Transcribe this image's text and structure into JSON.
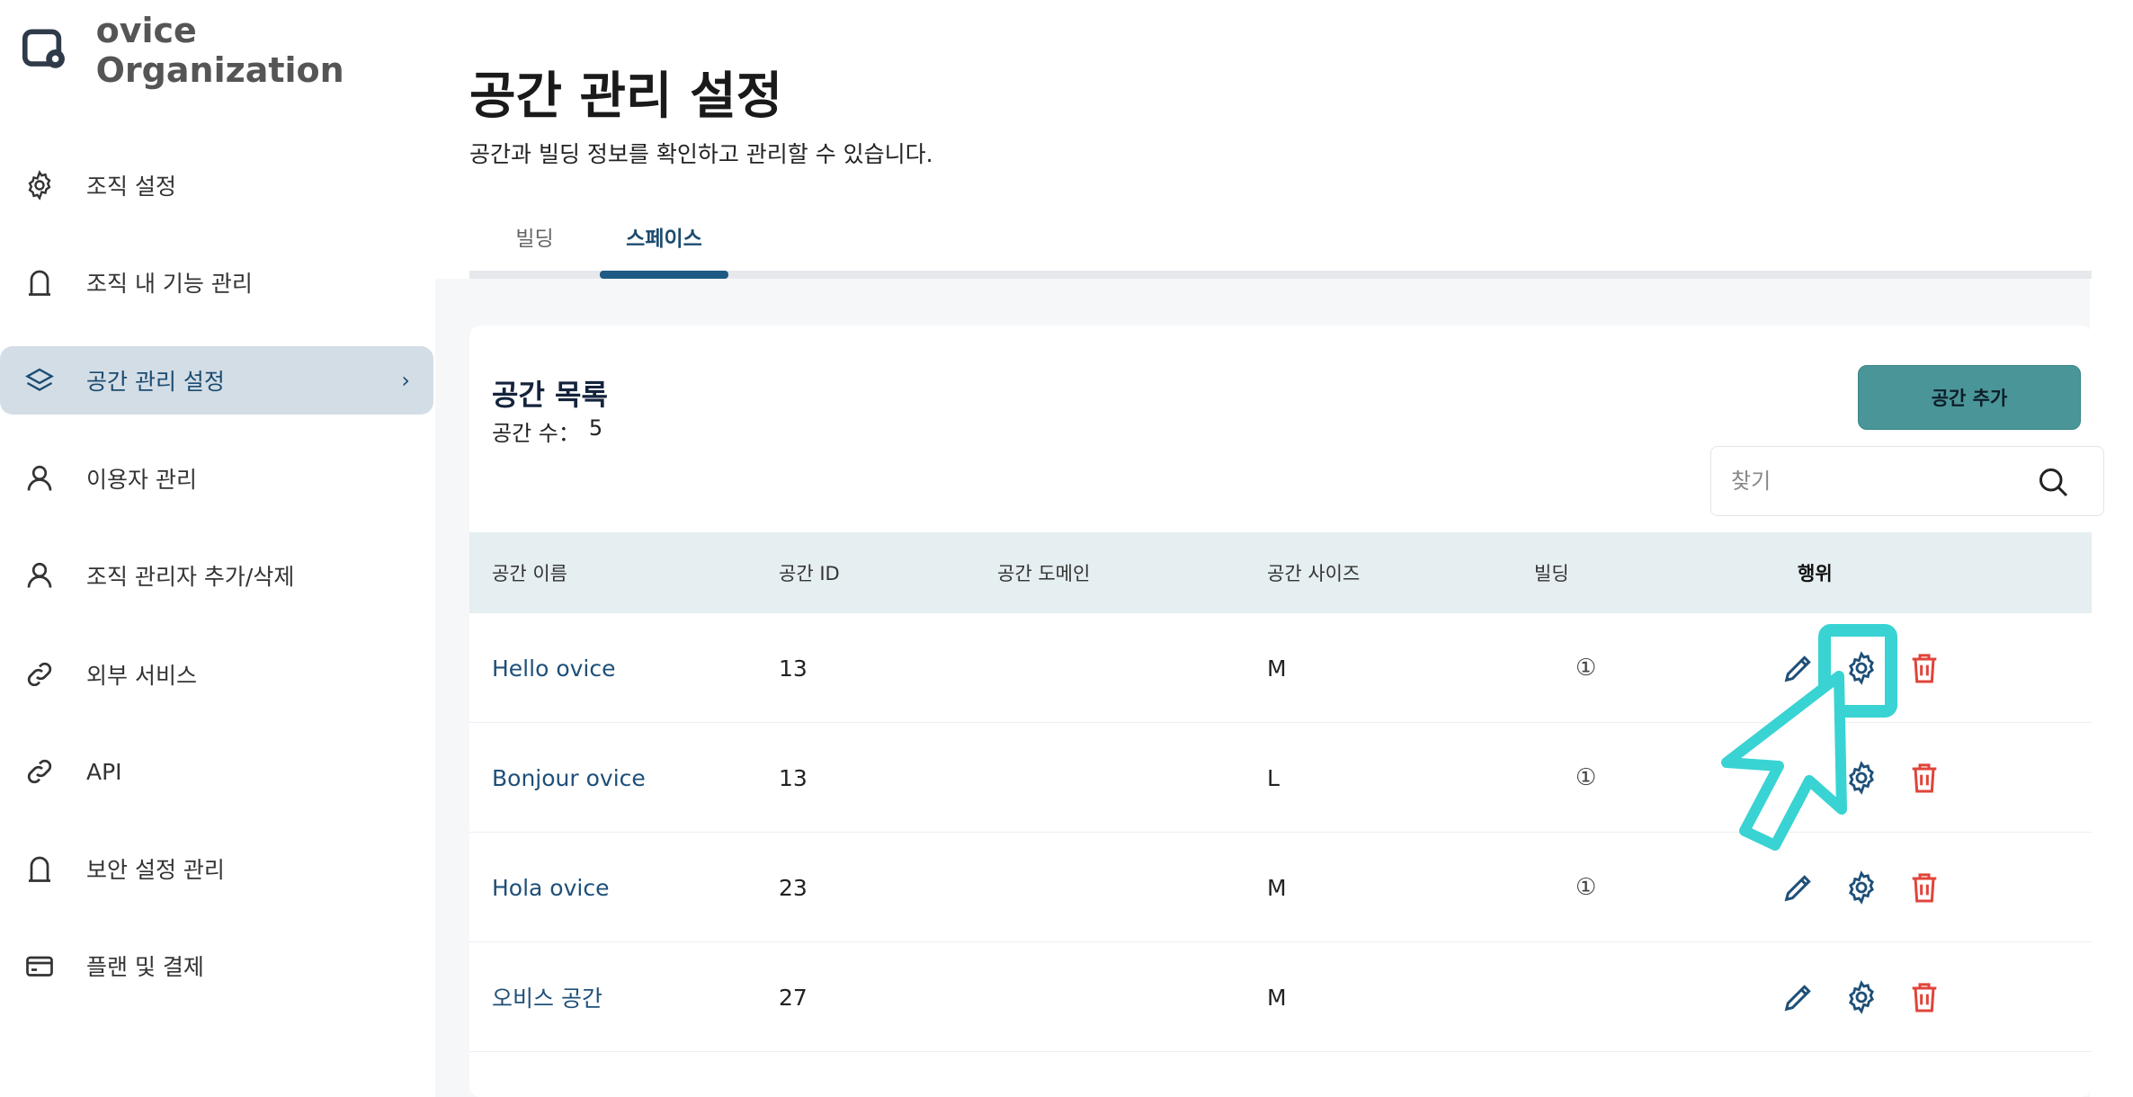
{
  "sidebar": {
    "org_name": "ovice Organization",
    "items": [
      {
        "label": "조직 설정",
        "icon": "gear-icon"
      },
      {
        "label": "조직 내 기능 관리",
        "icon": "lock-icon"
      },
      {
        "label": "공간 관리 설정",
        "icon": "layers-icon",
        "active": true
      },
      {
        "label": "이용자 관리",
        "icon": "user-icon"
      },
      {
        "label": "조직 관리자 추가/삭제",
        "icon": "user-icon"
      },
      {
        "label": "외부 서비스",
        "icon": "link-icon"
      },
      {
        "label": "API",
        "icon": "link-icon"
      },
      {
        "label": "보안 설정 관리",
        "icon": "lock-icon"
      },
      {
        "label": "플랜 및 결제",
        "icon": "credit-card-icon"
      }
    ],
    "active_chevron": "›"
  },
  "header": {
    "title": "공간 관리 설정",
    "subtitle": "공간과 빌딩 정보를 확인하고 관리할 수 있습니다."
  },
  "tabs": [
    {
      "label": "빌딩"
    },
    {
      "label": "스페이스",
      "active": true
    }
  ],
  "card": {
    "title": "공간 목록",
    "count_label": "공간 수：",
    "count_value": "5",
    "add_button": "공간 추가",
    "search_placeholder": "찾기"
  },
  "table": {
    "columns": [
      "공간 이름",
      "공간 ID",
      "공간 도메인",
      "공간 사이즈",
      "빌딩",
      "행위"
    ],
    "rows": [
      {
        "name": "Hello ovice",
        "id": "13",
        "domain": "",
        "size": "M",
        "building": "①"
      },
      {
        "name": "Bonjour ovice",
        "id": "13",
        "domain": "",
        "size": "L",
        "building": "①"
      },
      {
        "name": "Hola ovice",
        "id": "23",
        "domain": "",
        "size": "M",
        "building": "①"
      },
      {
        "name": "오비스 공간",
        "id": "27",
        "domain": "",
        "size": "M",
        "building": ""
      }
    ]
  },
  "colors": {
    "accent": "#1f5a84",
    "button": "#4a9597",
    "delete": "#e0443a",
    "highlight": "#39d3d3"
  }
}
